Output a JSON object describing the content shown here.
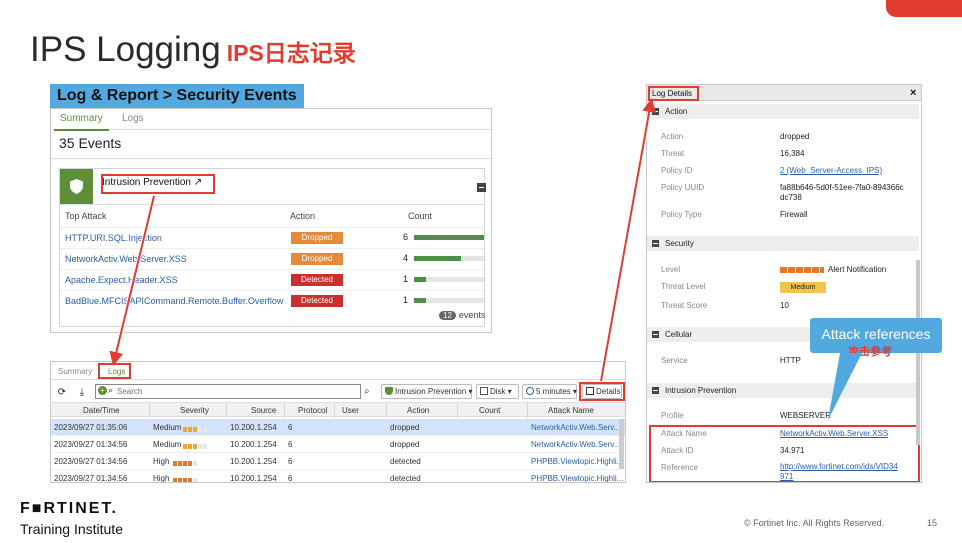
{
  "slide": {
    "title": "IPS Logging",
    "title_cn": "IPS日志记录",
    "logo": "F■RTINET.",
    "logo_sub": "Training Institute",
    "copyright": "© Fortinet Inc. All Rights Reserved.",
    "page_number": "15",
    "accent_color": "#e03c2f"
  },
  "summary_widget": {
    "banner": "Log & Report > Security Events",
    "tabs": [
      "Summary",
      "Logs"
    ],
    "events_count": "35 Events",
    "panel_title": "Intrusion Prevention",
    "columns": [
      "Top Attack",
      "Action",
      "Count"
    ],
    "rows": [
      {
        "attack": "HTTP.URI.SQL.Injection",
        "action": "Dropped",
        "count": "6",
        "fraction": 1.0
      },
      {
        "attack": "NetworkActiv.Web.Server.XSS",
        "action": "Dropped",
        "count": "4",
        "fraction": 0.67
      },
      {
        "attack": "Apache.Expect.Header.XSS",
        "action": "Detected",
        "count": "1",
        "fraction": 0.17
      },
      {
        "attack": "BadBlue.MFCISAPICommand.Remote.Buffer.Overflow",
        "action": "Detected",
        "count": "1",
        "fraction": 0.17
      }
    ],
    "events_total": "12",
    "events_label": "events"
  },
  "logs_widget": {
    "tabs": [
      "Summary",
      "Logs"
    ],
    "search_placeholder": "Search",
    "filter_chip": "Intrusion Prevention ▾",
    "disk_chip": "Disk ▾",
    "time_chip": "5 minutes ▾",
    "details_button": "Details",
    "columns": [
      "Date/Time",
      "Severity",
      "Source",
      "Protocol",
      "User",
      "Action",
      "Count",
      "Attack Name"
    ],
    "rows": [
      {
        "time": "2023/09/27 01:35:06",
        "severity": "Medium",
        "level": 0.6,
        "source": "10.200.1.254",
        "protocol": "6",
        "user": "",
        "action": "dropped",
        "count": "",
        "attack": "NetworkActiv.Web.Serv..."
      },
      {
        "time": "2023/09/27 01:34:56",
        "severity": "Medium",
        "level": 0.6,
        "source": "10.200.1.254",
        "protocol": "6",
        "user": "",
        "action": "dropped",
        "count": "",
        "attack": "NetworkActiv.Web.Serv..."
      },
      {
        "time": "2023/09/27 01:34:56",
        "severity": "High",
        "level": 0.8,
        "source": "10.200.1.254",
        "protocol": "6",
        "user": "",
        "action": "detected",
        "count": "",
        "attack": "PHPBB.Viewtopic.Highli..."
      },
      {
        "time": "2023/09/27 01:34:56",
        "severity": "High",
        "level": 0.8,
        "source": "10.200.1.254",
        "protocol": "6",
        "user": "",
        "action": "detected",
        "count": "",
        "attack": "PHPBB.Viewtopic.Highli..."
      }
    ]
  },
  "log_details": {
    "title": "Log Details",
    "close": "×",
    "action_section": "Action",
    "action_fields": [
      {
        "k": "Action",
        "v": "dropped"
      },
      {
        "k": "Threat",
        "v": "16,384"
      },
      {
        "k": "Policy ID",
        "v": "2 (Web_Server-Access_IPS)"
      },
      {
        "k": "Policy UUID",
        "v": "fa88b646-5d0f-51ee-7fa0-894366c",
        "v2": "dc738"
      },
      {
        "k": "Policy Type",
        "v": "Firewall"
      }
    ],
    "security_section": "Security",
    "level_label": "Level",
    "level_text": "Alert Notification",
    "threat_level_label": "Threat Level",
    "threat_level_value": "Medium",
    "threat_score_label": "Threat Score",
    "threat_score_value": "10",
    "cellular_section": "Cellular",
    "service_label": "Service",
    "service_value": "HTTP",
    "ips_section": "Intrusion Prevention",
    "profile_label": "Profile",
    "profile_value": "WEBSERVER",
    "attack_name_label": "Attack Name",
    "attack_name_value": "NetworkActiv.Web.Server.XSS",
    "attack_id_label": "Attack ID",
    "attack_id_value": "34,971",
    "reference_label": "Reference",
    "reference_value": "http://www.fortinet.com/ids/VID34",
    "reference_value2": "971"
  },
  "callout": {
    "text": "Attack references",
    "text_cn": "攻击参考"
  }
}
